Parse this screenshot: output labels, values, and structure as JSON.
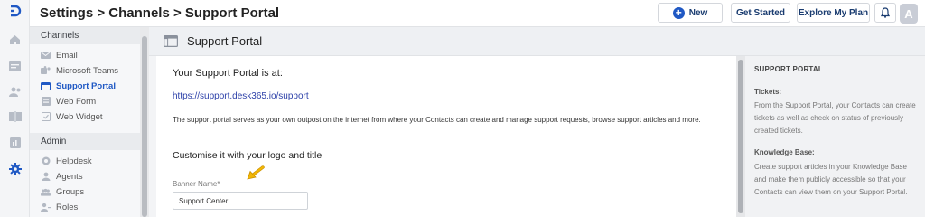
{
  "header": {
    "breadcrumb": [
      "Settings",
      ">",
      "Channels",
      ">",
      "Support Portal"
    ],
    "new_label": "New",
    "get_started_label": "Get Started",
    "explore_label": "Explore My Plan",
    "avatar_letter": "A"
  },
  "rail": {
    "icons": [
      "logo-icon",
      "home-icon",
      "tickets-icon",
      "contacts-icon",
      "knowledge-base-icon",
      "reports-icon",
      "settings-icon"
    ],
    "active": "settings-icon"
  },
  "menu": {
    "channels_title": "Channels",
    "channels": [
      {
        "label": "Email",
        "icon": "email-icon"
      },
      {
        "label": "Microsoft Teams",
        "icon": "teams-icon"
      },
      {
        "label": "Support Portal",
        "icon": "portal-icon",
        "active": true
      },
      {
        "label": "Web Form",
        "icon": "web-form-icon"
      },
      {
        "label": "Web Widget",
        "icon": "web-widget-icon"
      }
    ],
    "admin_title": "Admin",
    "admin": [
      {
        "label": "Helpdesk",
        "icon": "helpdesk-icon"
      },
      {
        "label": "Agents",
        "icon": "agents-icon"
      },
      {
        "label": "Groups",
        "icon": "groups-icon"
      },
      {
        "label": "Roles",
        "icon": "roles-icon"
      }
    ]
  },
  "page": {
    "title": "Support Portal",
    "portal_heading": "Your Support Portal is at:",
    "portal_url": "https://support.desk365.io/support",
    "description": "The support portal serves as your own outpost on the internet from where your Contacts can create and manage support requests, browse support articles and more.",
    "customise_heading": "Customise it with your logo and title",
    "banner_label": "Banner Name*",
    "banner_value": "Support Center"
  },
  "help": {
    "title": "SUPPORT PORTAL",
    "tickets_title": "Tickets:",
    "tickets_text": "From the Support Portal, your Contacts can create tickets as well as check on status of previously created tickets.",
    "kb_title": "Knowledge Base:",
    "kb_text": "Create support articles in your Knowledge Base and make them publicly accessible so that your Contacts can view them on your Support Portal."
  },
  "colors": {
    "accent": "#1f58c4",
    "link": "#2b3fa8",
    "arrow": "#f2b705"
  }
}
